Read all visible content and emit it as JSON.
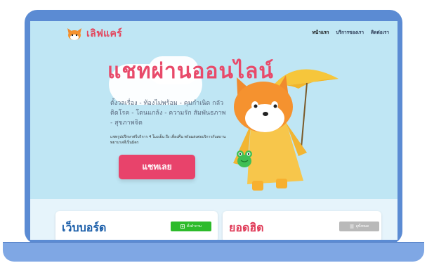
{
  "brand": {
    "name": "เลิฟแคร์",
    "icon": "fox-logo-icon"
  },
  "nav": {
    "items": [
      "หน้าแรก",
      "บริการของเรา",
      "ติดต่อเรา"
    ]
  },
  "hero": {
    "title": "แชทผ่านออนไลน์",
    "tagline": "ตั้งวลเรื่อง - ท้องไม่พร้อม - คุมกำเนิด กลัวติดโรค - โดนแกล้ง - ความรัก สัมพันธภาพ - สุขภาพจิต",
    "note": "แชทรูปปรึกษาฟรีบริการ 4 โมงเย็น ถึง เที่ยงคืน พร้อมส่งต่อบริการกับสถานพยาบาลที่เป็นมิตร",
    "cta_label": "แชทเลย"
  },
  "cards": {
    "webboard": {
      "title": "เว็บบอร์ด",
      "button_label": "ตั้งคำถาม",
      "button_icon": "plus-square-icon"
    },
    "top": {
      "title": "ยอดฮิต",
      "button_label": "ดูทั้งหมด",
      "button_icon": "list-icon"
    }
  },
  "colors": {
    "accent": "#e8436b",
    "brand_text": "#e3465d",
    "title_blue": "#1b5ea9",
    "device": "#5b8bd3",
    "screen_bg": "#bfe6f4",
    "green": "#2dbb2b"
  }
}
